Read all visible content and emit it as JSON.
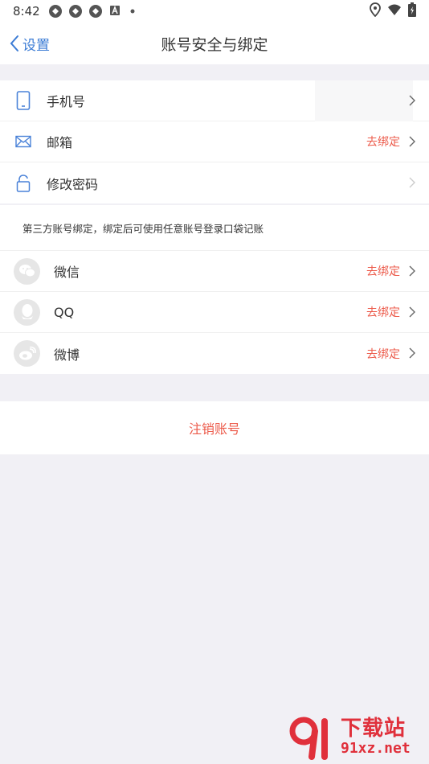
{
  "status_bar": {
    "time": "8:42",
    "icons": [
      "app-icon",
      "app-icon",
      "app-icon",
      "a-icon",
      "dot-icon"
    ],
    "right_icons": [
      "location-icon",
      "wifi-icon",
      "battery-icon"
    ]
  },
  "nav": {
    "back_label": "设置",
    "title": "账号安全与绑定"
  },
  "account": {
    "phone_label": "手机号",
    "email_label": "邮箱",
    "email_action": "去绑定",
    "password_label": "修改密码"
  },
  "third_party": {
    "note": "第三方账号绑定，绑定后可使用任意账号登录口袋记账",
    "items": [
      {
        "label": "微信",
        "action": "去绑定",
        "icon": "wechat-icon"
      },
      {
        "label": "QQ",
        "action": "去绑定",
        "icon": "qq-icon"
      },
      {
        "label": "微博",
        "action": "去绑定",
        "icon": "weibo-icon"
      }
    ]
  },
  "logout_label": "注销账号",
  "watermark": {
    "title": "下载站",
    "domain": "91xz.net"
  },
  "colors": {
    "accent_blue": "#3a7bd5",
    "action_red": "#ec5a4a",
    "background": "#f1f0f5"
  }
}
